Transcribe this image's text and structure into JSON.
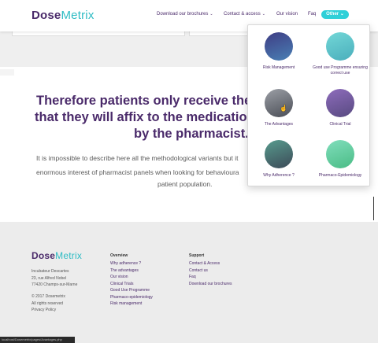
{
  "logo": {
    "part1": "Dose",
    "part2": "Metrix"
  },
  "nav": {
    "brochures": "Download our brochures",
    "contact": "Contact & access",
    "vision": "Our vision",
    "faq": "Faq",
    "other": "Other"
  },
  "main": {
    "headline_line1": "Therefore patients only receive the e",
    "headline_line2": "that they will affix to the medication l",
    "headline_line3": "by the pharmacist.",
    "body_line1": "It is impossible to describe here all the methodological variants but it",
    "body_line2": "enormous interest of pharmacist panels when looking for behavioura",
    "body_line3": "patient population."
  },
  "dropdown": {
    "items": [
      {
        "label": "Risk Management",
        "color1": "#1c1a6e",
        "color2": "#2a6aa8"
      },
      {
        "label": "Good use Programme ensuring correct use",
        "color1": "#5ad0d0",
        "color2": "#2aa0b0"
      },
      {
        "label": "The Advantages",
        "color1": "#8a8e96",
        "color2": "#2a2e38"
      },
      {
        "label": "Clinical Trial",
        "color1": "#7a52b0",
        "color2": "#3a2a6a"
      },
      {
        "label": "Why Adherence ?",
        "color1": "#3a8a7a",
        "color2": "#1a2a3a"
      },
      {
        "label": "Pharmaco-Epidemiology",
        "color1": "#6ad8b0",
        "color2": "#2ab070"
      }
    ]
  },
  "footer": {
    "address": [
      "Incubateur Descartes",
      "23, rue Alfred Nobel",
      "77420 Champs-sur-Marne"
    ],
    "copyright": "© 2017 Dosemetrix",
    "rights": "All rights reserved",
    "privacy": "Privacy Policy",
    "overview_title": "Overview",
    "overview_links": [
      "Why adherence ?",
      "The advantages",
      "Our vision",
      "Clinical Trials",
      "Good Use Programme",
      "Pharmaco-epidemiology",
      "Risk management"
    ],
    "support_title": "Support",
    "support_links": [
      "Contact & Access",
      "Contact us",
      "Faq",
      "Download our brochures"
    ]
  },
  "status_url": "localhost/Dosemetrix/pages/Avantages.php"
}
